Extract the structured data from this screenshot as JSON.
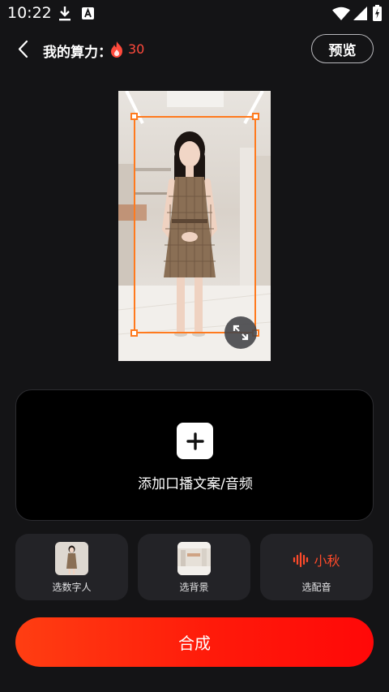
{
  "status_bar": {
    "time": "10:22",
    "icons": [
      "download-icon",
      "keyboard-a-icon",
      "wifi-icon",
      "signal-icon",
      "battery-charging-icon"
    ]
  },
  "header": {
    "back_icon": "chevron-left-icon",
    "quota_label": "我的算力：",
    "quota_icon": "fire-icon",
    "quota_value": "30",
    "preview_label": "预览"
  },
  "avatar_preview": {
    "expand_icon": "expand-icon"
  },
  "script_card": {
    "add_icon": "plus-icon",
    "label": "添加口播文案/音频"
  },
  "options": [
    {
      "label": "选数字人"
    },
    {
      "label": "选背景"
    },
    {
      "label": "选配音",
      "voice_icon": "sound-wave-icon",
      "voice_name": "小秋"
    }
  ],
  "compose_label": "合成",
  "colors": {
    "background": "#141416",
    "accent_red": "#ff4a3c",
    "selection_orange": "#ff7a1e",
    "button_gradient_start": "#ff3e12",
    "button_gradient_end": "#ff0808"
  }
}
